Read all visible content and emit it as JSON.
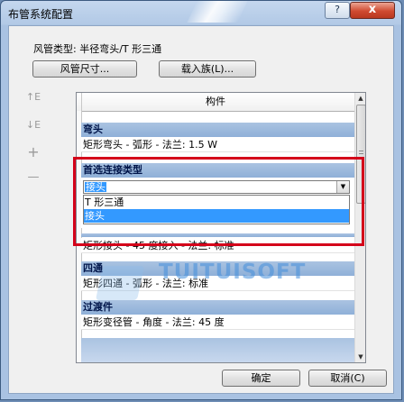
{
  "window": {
    "title": "布管系统配置",
    "help_label": "?",
    "close_label": "x"
  },
  "pipe_type": {
    "label": "风管类型:  半径弯头/T 形三通"
  },
  "buttons": {
    "duct_size": "风管尺寸...",
    "load_family": "载入族(L)...",
    "ok": "确定",
    "cancel": "取消(C)"
  },
  "side_icons": [
    "move-row-up-icon",
    "move-row-down-icon",
    "add-row-icon",
    "remove-row-icon"
  ],
  "side_glyphs": [
    "↑E",
    "↓E",
    "+",
    "—"
  ],
  "table": {
    "header": "构件",
    "groups": [
      {
        "title": "弯头",
        "item": "矩形弯头 - 弧形 - 法兰: 1.5 W"
      },
      {
        "title": "首选连接类型"
      },
      {
        "title": "",
        "item": "矩形接头 - 45 度接入 - 法兰: 标准"
      },
      {
        "title": "四通",
        "item": "矩形四通 - 弧形 - 法兰: 标准"
      },
      {
        "title": "过渡件",
        "item": "矩形变径管 - 角度 - 法兰: 45 度"
      }
    ]
  },
  "connection_dropdown": {
    "selected": "接头",
    "options": [
      "T 形三通",
      "接头"
    ],
    "highlighted_option": "接头"
  },
  "watermark": {
    "text": "TUITUISOFT"
  },
  "colors": {
    "group_row": "#8fb0d8",
    "selection": "#3399ff",
    "highlight_border": "#d4001a",
    "title_bar": "#b2c9e6"
  }
}
